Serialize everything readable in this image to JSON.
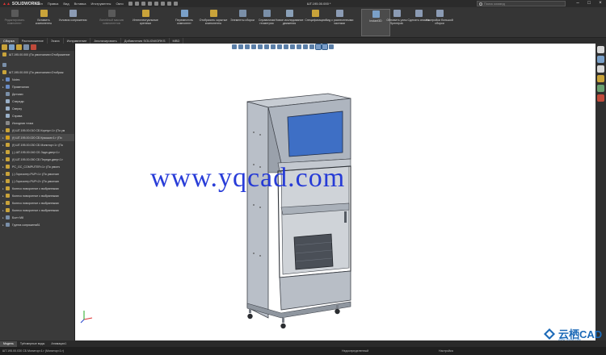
{
  "titlebar": {
    "logo": "SOLIDWORKS",
    "menus": [
      "Файл",
      "Правка",
      "Вид",
      "Вставка",
      "Инструменты",
      "Окно"
    ],
    "doc_title": "ШТ.195.00.000 *",
    "search_placeholder": "Поиск команд"
  },
  "ribbon": {
    "buttons": [
      {
        "label": "Редактировать компонент",
        "state": "dim",
        "color": "#5a5a5a"
      },
      {
        "label": "Вставить компоненты",
        "state": "normal",
        "color": "#c9a33a"
      },
      {
        "label": "Условия сопряжения",
        "state": "normal",
        "color": "#8b9bb4"
      },
      {
        "label": "Линейный массив компонентов",
        "state": "dim",
        "color": "#5a5a5a"
      },
      {
        "label": "Интеллектуальные крепежи",
        "state": "normal",
        "color": "#c9a33a"
      },
      {
        "label": "Переместить компонент",
        "state": "normal",
        "color": "#7aa0c8"
      },
      {
        "label": "Отобразить скрытые компоненты",
        "state": "normal",
        "color": "#c9a33a"
      },
      {
        "label": "Элементы сборки",
        "state": "normal",
        "color": "#7a8fa8"
      },
      {
        "label": "Справочная геометрия",
        "state": "normal",
        "color": "#7a8fa8"
      },
      {
        "label": "Новое исследование движения",
        "state": "normal",
        "color": "#8aa0b8"
      },
      {
        "label": "Спецификация",
        "state": "normal",
        "color": "#c9a33a"
      },
      {
        "label": "Вид с разнесенными частями",
        "state": "normal",
        "color": "#8b9bb4"
      },
      {
        "label": "Instant3D",
        "state": "active",
        "color": "#7aa0c8"
      },
      {
        "label": "Обновить узлы Speedpak",
        "state": "normal",
        "color": "#8b9bb4"
      },
      {
        "label": "Сделать снимок",
        "state": "normal",
        "color": "#8b9bb4"
      },
      {
        "label": "Настройки большой сборки",
        "state": "normal",
        "color": "#8b9bb4"
      }
    ]
  },
  "command_tabs": [
    "Сборка",
    "Расположение",
    "Эскиз",
    "Исправление",
    "Анализировать",
    "Добавления SOLIDWORKS",
    "MBD"
  ],
  "active_command_tab": 0,
  "feature_manager": {
    "tab_colors": [
      "#c9a33a",
      "#7aa0c8",
      "#c9a33a",
      "#7a8fa8",
      "#c04a3a"
    ],
    "top_row": "ШТ.195.00.000 (По умолчанию<Отображение",
    "root": "ШТ.195.00.000 (По умолчанию<Отображ",
    "items": [
      {
        "label": "Notes",
        "icon_color": "#6a8cc6",
        "expand": "▸"
      },
      {
        "label": "Примечания",
        "icon_color": "#6a8cc6",
        "expand": "▸"
      },
      {
        "label": "Датчики",
        "icon_color": "#7a8fa8",
        "expand": ""
      },
      {
        "label": "Спереди",
        "icon_color": "#9ab0c8",
        "expand": ""
      },
      {
        "label": "Сверху",
        "icon_color": "#9ab0c8",
        "expand": ""
      },
      {
        "label": "Справа",
        "icon_color": "#9ab0c8",
        "expand": ""
      },
      {
        "label": "Исходная точка",
        "icon_color": "#888888",
        "expand": ""
      },
      {
        "label": "(f) ШТ.195.00.010 СБ Корпус<1> (По ум",
        "icon_color": "#c9a33a",
        "expand": "▸"
      },
      {
        "label": "(f) ШТ.195.00.020 СБ Крышка<1> (По",
        "icon_color": "#d4a020",
        "expand": "▸",
        "highlight": true
      },
      {
        "label": "(f) ШТ.195.00.030 СБ Монитор<1> (По",
        "icon_color": "#c9a33a",
        "expand": "▸"
      },
      {
        "label": "(-) ШТ.195.00.040 СБ Задн.двер<1>",
        "icon_color": "#c9a33a",
        "expand": "▸"
      },
      {
        "label": "(f) ШТ.195.00.050 СБ Передн.двер<1>",
        "icon_color": "#c9a33a",
        "expand": "▸"
      },
      {
        "label": "PC_GC_COMPUTER<1> (По умолч",
        "icon_color": "#c9a33a",
        "expand": "▸"
      },
      {
        "label": "(-) Горизонтр.PUP<1> (По умолчан",
        "icon_color": "#c9a33a",
        "expand": "▸"
      },
      {
        "label": "(-) Горизонтр.PUP<2> (По умолчан",
        "icon_color": "#c9a33a",
        "expand": "▸"
      },
      {
        "label": "Колесо поворотное с выбранными",
        "icon_color": "#c9a33a",
        "expand": "▸"
      },
      {
        "label": "Колесо поворотное с выбранными",
        "icon_color": "#c9a33a",
        "expand": "▸"
      },
      {
        "label": "Колесо поворотное с выбранными",
        "icon_color": "#c9a33a",
        "expand": "▸"
      },
      {
        "label": "Колесо поворотное с выбранными",
        "icon_color": "#c9a33a",
        "expand": "▸"
      },
      {
        "label": "Болт M8",
        "icon_color": "#7a8fa8",
        "expand": "▸"
      },
      {
        "label": "Группа сопряжений1",
        "icon_color": "#7a8fa8",
        "expand": "▸"
      }
    ]
  },
  "viewport": {
    "watermark": "www.yqcad.com"
  },
  "taskpane": {
    "icon_colors": [
      "#d8d8d8",
      "#7aa0c8",
      "#d8d8d8",
      "#c9a33a",
      "#6aa070",
      "#c04a3a"
    ]
  },
  "bottom_tabs": [
    "Модель",
    "Трёхмерные виды",
    "Анимация1"
  ],
  "active_bottom_tab": 0,
  "status": {
    "left": "ШТ.195.00.030 СБ Монитор<1> (Монитор<1>)",
    "state": "Недоопределенный",
    "units": "Настройка"
  },
  "brand": {
    "name": "云栖CAD",
    "sub": "WWW.YQCAD.COM"
  }
}
